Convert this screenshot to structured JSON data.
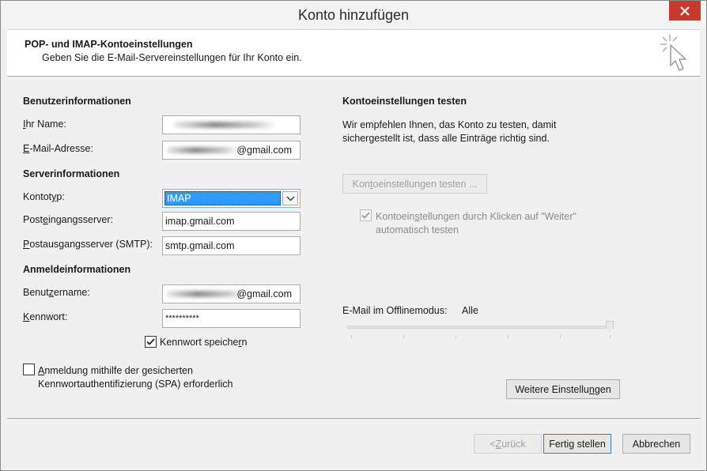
{
  "window": {
    "title": "Konto hinzufügen",
    "close_icon": "close-icon"
  },
  "header": {
    "title": "POP- und IMAP-Kontoeinstellungen",
    "subtitle": "Geben Sie die E-Mail-Servereinstellungen für Ihr Konto ein.",
    "icon": "sparkle-cursor-icon"
  },
  "user_info": {
    "section_title": "Benutzerinformationen",
    "name_label_u": "I",
    "name_label_rest": "hr Name:",
    "name_value": "",
    "email_label_u": "E",
    "email_label_rest": "-Mail-Adresse:",
    "email_value": "@gmail.com"
  },
  "server_info": {
    "section_title": "Serverinformationen",
    "account_type_label_pre": "Kontot",
    "account_type_label_u": "y",
    "account_type_label_post": "p:",
    "account_type_value": "IMAP",
    "incoming_label_pre": "Post",
    "incoming_label_u": "e",
    "incoming_label_post": "ingangsserver:",
    "incoming_value": "imap.gmail.com",
    "outgoing_label_pre": "",
    "outgoing_label_u": "P",
    "outgoing_label_post": "ostausgangsserver (SMTP):",
    "outgoing_value": "smtp.gmail.com"
  },
  "login_info": {
    "section_title": "Anmeldeinformationen",
    "username_label_pre": "Benut",
    "username_label_u": "z",
    "username_label_post": "ername:",
    "username_value": "@gmail.com",
    "password_label_pre": "",
    "password_label_u": "K",
    "password_label_post": "ennwort:",
    "password_value": "**********",
    "remember_pre": "Kennwort speiche",
    "remember_u": "r",
    "remember_post": "n",
    "remember_checked": true,
    "spa_line1_pre": "",
    "spa_line1_u": "A",
    "spa_line1_post": "nmeldung mithilfe der gesicherten",
    "spa_line2": "Kennwortauthentifizierung (SPA) erforderlich",
    "spa_checked": false
  },
  "test_settings": {
    "section_title": "Kontoeinstellungen testen",
    "description_line1": "Wir empfehlen Ihnen, das Konto zu testen, damit",
    "description_line2": "sichergestellt ist, dass alle Einträge richtig sind.",
    "test_button_pre": "Kon",
    "test_button_u": "t",
    "test_button_post": "oeinstellungen testen ...",
    "auto_test_line1_pre": "Kontoein",
    "auto_test_line1_u": "s",
    "auto_test_line1_post": "tellungen durch Klicken auf \"Weiter\"",
    "auto_test_line2": "automatisch testen",
    "auto_test_checked": true
  },
  "offline": {
    "label": "E-Mail im Offlinemodus:",
    "value": "Alle",
    "level_fraction": 1.0
  },
  "more_settings_button_pre": "Weitere Einstellu",
  "more_settings_button_u": "n",
  "more_settings_button_post": "gen",
  "footer": {
    "back_pre": "< ",
    "back_u": "Z",
    "back_post": "urück",
    "finish": "Fertig stellen",
    "cancel": "Abbrechen"
  },
  "colors": {
    "close_red": "#c7392c",
    "selection_blue": "#3399ff"
  }
}
